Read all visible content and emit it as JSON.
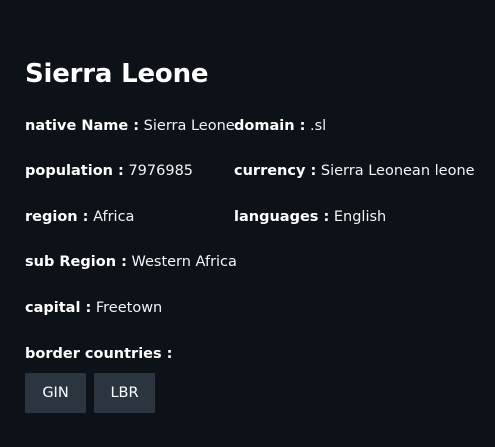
{
  "country": {
    "name": "Sierra Leone"
  },
  "details": {
    "native_name_label": "native Name :",
    "native_name_value": "Sierra Leone",
    "population_label": "population :",
    "population_value": "7976985",
    "region_label": "region :",
    "region_value": "Africa",
    "sub_region_label": "sub Region :",
    "sub_region_value": "Western Africa",
    "capital_label": "capital :",
    "capital_value": "Freetown",
    "domain_label": "domain :",
    "domain_value": ".sl",
    "currency_label": "currency :",
    "currency_value": "Sierra Leonean leone",
    "languages_label": "languages :",
    "languages_value": "English"
  },
  "borders": {
    "label": "border countries :",
    "items": [
      {
        "label": "GIN"
      },
      {
        "label": "LBR"
      }
    ]
  },
  "colors": {
    "background": "#0d1218",
    "chip_background": "#2a3540",
    "text": "#ffffff"
  }
}
